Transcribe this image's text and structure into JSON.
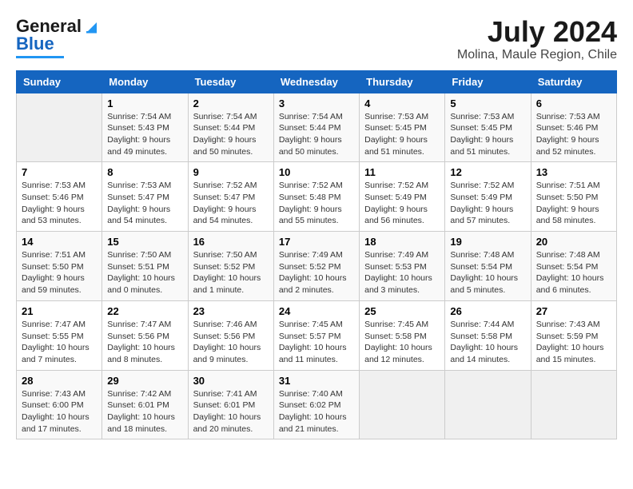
{
  "header": {
    "logo_line1": "General",
    "logo_line2": "Blue",
    "title": "July 2024",
    "subtitle": "Molina, Maule Region, Chile"
  },
  "weekdays": [
    "Sunday",
    "Monday",
    "Tuesday",
    "Wednesday",
    "Thursday",
    "Friday",
    "Saturday"
  ],
  "weeks": [
    [
      {
        "day": "",
        "sunrise": "",
        "sunset": "",
        "daylight": ""
      },
      {
        "day": "1",
        "sunrise": "Sunrise: 7:54 AM",
        "sunset": "Sunset: 5:43 PM",
        "daylight": "Daylight: 9 hours and 49 minutes."
      },
      {
        "day": "2",
        "sunrise": "Sunrise: 7:54 AM",
        "sunset": "Sunset: 5:44 PM",
        "daylight": "Daylight: 9 hours and 50 minutes."
      },
      {
        "day": "3",
        "sunrise": "Sunrise: 7:54 AM",
        "sunset": "Sunset: 5:44 PM",
        "daylight": "Daylight: 9 hours and 50 minutes."
      },
      {
        "day": "4",
        "sunrise": "Sunrise: 7:53 AM",
        "sunset": "Sunset: 5:45 PM",
        "daylight": "Daylight: 9 hours and 51 minutes."
      },
      {
        "day": "5",
        "sunrise": "Sunrise: 7:53 AM",
        "sunset": "Sunset: 5:45 PM",
        "daylight": "Daylight: 9 hours and 51 minutes."
      },
      {
        "day": "6",
        "sunrise": "Sunrise: 7:53 AM",
        "sunset": "Sunset: 5:46 PM",
        "daylight": "Daylight: 9 hours and 52 minutes."
      }
    ],
    [
      {
        "day": "7",
        "sunrise": "Sunrise: 7:53 AM",
        "sunset": "Sunset: 5:46 PM",
        "daylight": "Daylight: 9 hours and 53 minutes."
      },
      {
        "day": "8",
        "sunrise": "Sunrise: 7:53 AM",
        "sunset": "Sunset: 5:47 PM",
        "daylight": "Daylight: 9 hours and 54 minutes."
      },
      {
        "day": "9",
        "sunrise": "Sunrise: 7:52 AM",
        "sunset": "Sunset: 5:47 PM",
        "daylight": "Daylight: 9 hours and 54 minutes."
      },
      {
        "day": "10",
        "sunrise": "Sunrise: 7:52 AM",
        "sunset": "Sunset: 5:48 PM",
        "daylight": "Daylight: 9 hours and 55 minutes."
      },
      {
        "day": "11",
        "sunrise": "Sunrise: 7:52 AM",
        "sunset": "Sunset: 5:49 PM",
        "daylight": "Daylight: 9 hours and 56 minutes."
      },
      {
        "day": "12",
        "sunrise": "Sunrise: 7:52 AM",
        "sunset": "Sunset: 5:49 PM",
        "daylight": "Daylight: 9 hours and 57 minutes."
      },
      {
        "day": "13",
        "sunrise": "Sunrise: 7:51 AM",
        "sunset": "Sunset: 5:50 PM",
        "daylight": "Daylight: 9 hours and 58 minutes."
      }
    ],
    [
      {
        "day": "14",
        "sunrise": "Sunrise: 7:51 AM",
        "sunset": "Sunset: 5:50 PM",
        "daylight": "Daylight: 9 hours and 59 minutes."
      },
      {
        "day": "15",
        "sunrise": "Sunrise: 7:50 AM",
        "sunset": "Sunset: 5:51 PM",
        "daylight": "Daylight: 10 hours and 0 minutes."
      },
      {
        "day": "16",
        "sunrise": "Sunrise: 7:50 AM",
        "sunset": "Sunset: 5:52 PM",
        "daylight": "Daylight: 10 hours and 1 minute."
      },
      {
        "day": "17",
        "sunrise": "Sunrise: 7:49 AM",
        "sunset": "Sunset: 5:52 PM",
        "daylight": "Daylight: 10 hours and 2 minutes."
      },
      {
        "day": "18",
        "sunrise": "Sunrise: 7:49 AM",
        "sunset": "Sunset: 5:53 PM",
        "daylight": "Daylight: 10 hours and 3 minutes."
      },
      {
        "day": "19",
        "sunrise": "Sunrise: 7:48 AM",
        "sunset": "Sunset: 5:54 PM",
        "daylight": "Daylight: 10 hours and 5 minutes."
      },
      {
        "day": "20",
        "sunrise": "Sunrise: 7:48 AM",
        "sunset": "Sunset: 5:54 PM",
        "daylight": "Daylight: 10 hours and 6 minutes."
      }
    ],
    [
      {
        "day": "21",
        "sunrise": "Sunrise: 7:47 AM",
        "sunset": "Sunset: 5:55 PM",
        "daylight": "Daylight: 10 hours and 7 minutes."
      },
      {
        "day": "22",
        "sunrise": "Sunrise: 7:47 AM",
        "sunset": "Sunset: 5:56 PM",
        "daylight": "Daylight: 10 hours and 8 minutes."
      },
      {
        "day": "23",
        "sunrise": "Sunrise: 7:46 AM",
        "sunset": "Sunset: 5:56 PM",
        "daylight": "Daylight: 10 hours and 9 minutes."
      },
      {
        "day": "24",
        "sunrise": "Sunrise: 7:45 AM",
        "sunset": "Sunset: 5:57 PM",
        "daylight": "Daylight: 10 hours and 11 minutes."
      },
      {
        "day": "25",
        "sunrise": "Sunrise: 7:45 AM",
        "sunset": "Sunset: 5:58 PM",
        "daylight": "Daylight: 10 hours and 12 minutes."
      },
      {
        "day": "26",
        "sunrise": "Sunrise: 7:44 AM",
        "sunset": "Sunset: 5:58 PM",
        "daylight": "Daylight: 10 hours and 14 minutes."
      },
      {
        "day": "27",
        "sunrise": "Sunrise: 7:43 AM",
        "sunset": "Sunset: 5:59 PM",
        "daylight": "Daylight: 10 hours and 15 minutes."
      }
    ],
    [
      {
        "day": "28",
        "sunrise": "Sunrise: 7:43 AM",
        "sunset": "Sunset: 6:00 PM",
        "daylight": "Daylight: 10 hours and 17 minutes."
      },
      {
        "day": "29",
        "sunrise": "Sunrise: 7:42 AM",
        "sunset": "Sunset: 6:01 PM",
        "daylight": "Daylight: 10 hours and 18 minutes."
      },
      {
        "day": "30",
        "sunrise": "Sunrise: 7:41 AM",
        "sunset": "Sunset: 6:01 PM",
        "daylight": "Daylight: 10 hours and 20 minutes."
      },
      {
        "day": "31",
        "sunrise": "Sunrise: 7:40 AM",
        "sunset": "Sunset: 6:02 PM",
        "daylight": "Daylight: 10 hours and 21 minutes."
      },
      {
        "day": "",
        "sunrise": "",
        "sunset": "",
        "daylight": ""
      },
      {
        "day": "",
        "sunrise": "",
        "sunset": "",
        "daylight": ""
      },
      {
        "day": "",
        "sunrise": "",
        "sunset": "",
        "daylight": ""
      }
    ]
  ]
}
